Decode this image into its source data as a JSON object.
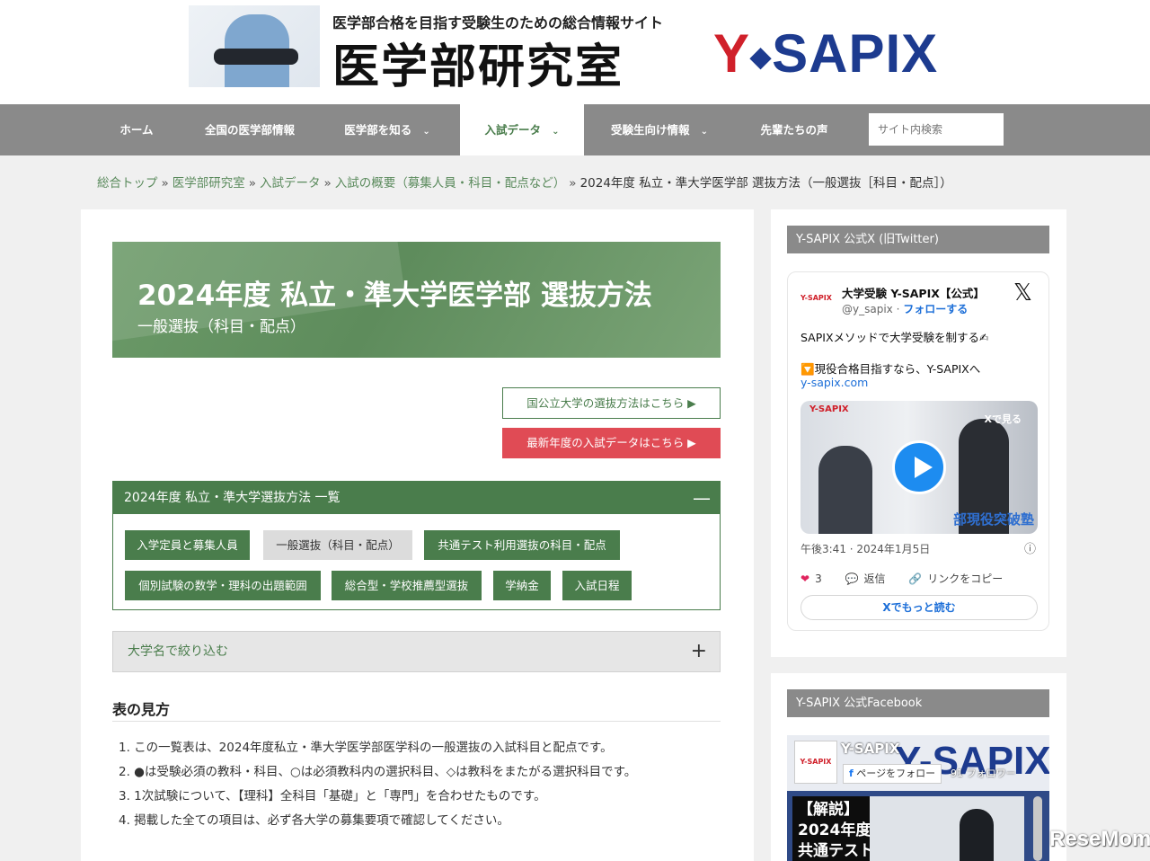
{
  "header": {
    "tagline": "医学部合格を目指す受験生のための総合情報サイト",
    "site_title": "医学部研究室",
    "logo_y": "Y",
    "logo_rest": "SAPIX"
  },
  "nav": {
    "items": [
      {
        "label": "ホーム"
      },
      {
        "label": "全国の医学部情報"
      },
      {
        "label": "医学部を知る"
      },
      {
        "label": "入試データ"
      },
      {
        "label": "受験生向け情報"
      },
      {
        "label": "先輩たちの声"
      }
    ],
    "active": "入試データ",
    "search_placeholder": "サイト内検索"
  },
  "breadcrumb": {
    "links": [
      "総合トップ",
      "医学部研究室",
      "入試データ",
      "入試の概要（募集人員・科目・配点など）"
    ],
    "current": "2024年度 私立・準大学医学部 選抜方法（一般選抜［科目・配点］）",
    "separator": "»"
  },
  "hero": {
    "title": "2024年度 私立・準大学医学部 選抜方法",
    "subtitle": "一般選抜（科目・配点）"
  },
  "buttons": {
    "national": "国公立大学の選抜方法はこちら ▶",
    "latest": "最新年度の入試データはこちら ▶"
  },
  "accordion": {
    "title": "2024年度 私立・準大学選抜方法 一覧",
    "toggle": "—",
    "tags": [
      "入学定員と募集人員",
      "一般選抜（科目・配点）",
      "共通テスト利用選抜の科目・配点",
      "個別試験の数学・理科の出題範囲",
      "総合型・学校推薦型選抜",
      "学納金",
      "入試日程"
    ],
    "current_tag": "一般選抜（科目・配点）"
  },
  "filter": {
    "label": "大学名で絞り込む",
    "toggle": "+"
  },
  "legend": {
    "title": "表の見方",
    "notes": [
      "1. この一覧表は、2024年度私立・準大学医学部医学科の一般選抜の入試科目と配点です。",
      "2. ●は受験必須の教科・科目、○は必須教科内の選択科目、◇は教科をまたがる選択科目です。",
      "3. 1次試験について、【理科】全科目「基礎」と「専門」を合わせたものです。",
      "4. 掲載した全ての項目は、必ず各大学の募集要項で確認してください。"
    ]
  },
  "sidebar": {
    "x_heading": "Y-SAPIX 公式X (旧Twitter)",
    "x_card": {
      "avatar_text": "Y-SAPIX",
      "name": "大学受験 Y-SAPIX【公式】",
      "handle": "@y_sapix",
      "handle_sep": " · ",
      "follow": "フォローする",
      "text1": "SAPIXメソッドで大学受験を制する✍",
      "text2": "🔽現役合格目指すなら、Y-SAPIXへ",
      "link": "y-sapix.com",
      "media_logo": "Y-SAPIX",
      "media_watch": "Xで見る",
      "media_caption": "部現役突破塾",
      "timestamp": "午後3:41 · 2024年1月5日",
      "likes": "3",
      "reply": "返信",
      "copy_link": "リンクをコピー",
      "read_more": "Xでもっと読む"
    },
    "fb_heading": "Y-SAPIX 公式Facebook",
    "fb_card": {
      "bg_text": "Y-SAPIX",
      "logo_text": "Y-SAPIX",
      "name": "Y-SAPIX",
      "follow": "ページをフォロー",
      "followers": "91 フォロワー",
      "post_text_1": "【解説】",
      "post_text_2": "2024年度",
      "post_text_3": "共通テスト"
    }
  },
  "watermark": "ReseMom",
  "colors": {
    "accent_green": "#4a7d4c",
    "nav_gray": "#8a8a8a",
    "cta_red": "#e04b55",
    "brand_red": "#d0202a",
    "brand_blue": "#1d3b8f"
  }
}
